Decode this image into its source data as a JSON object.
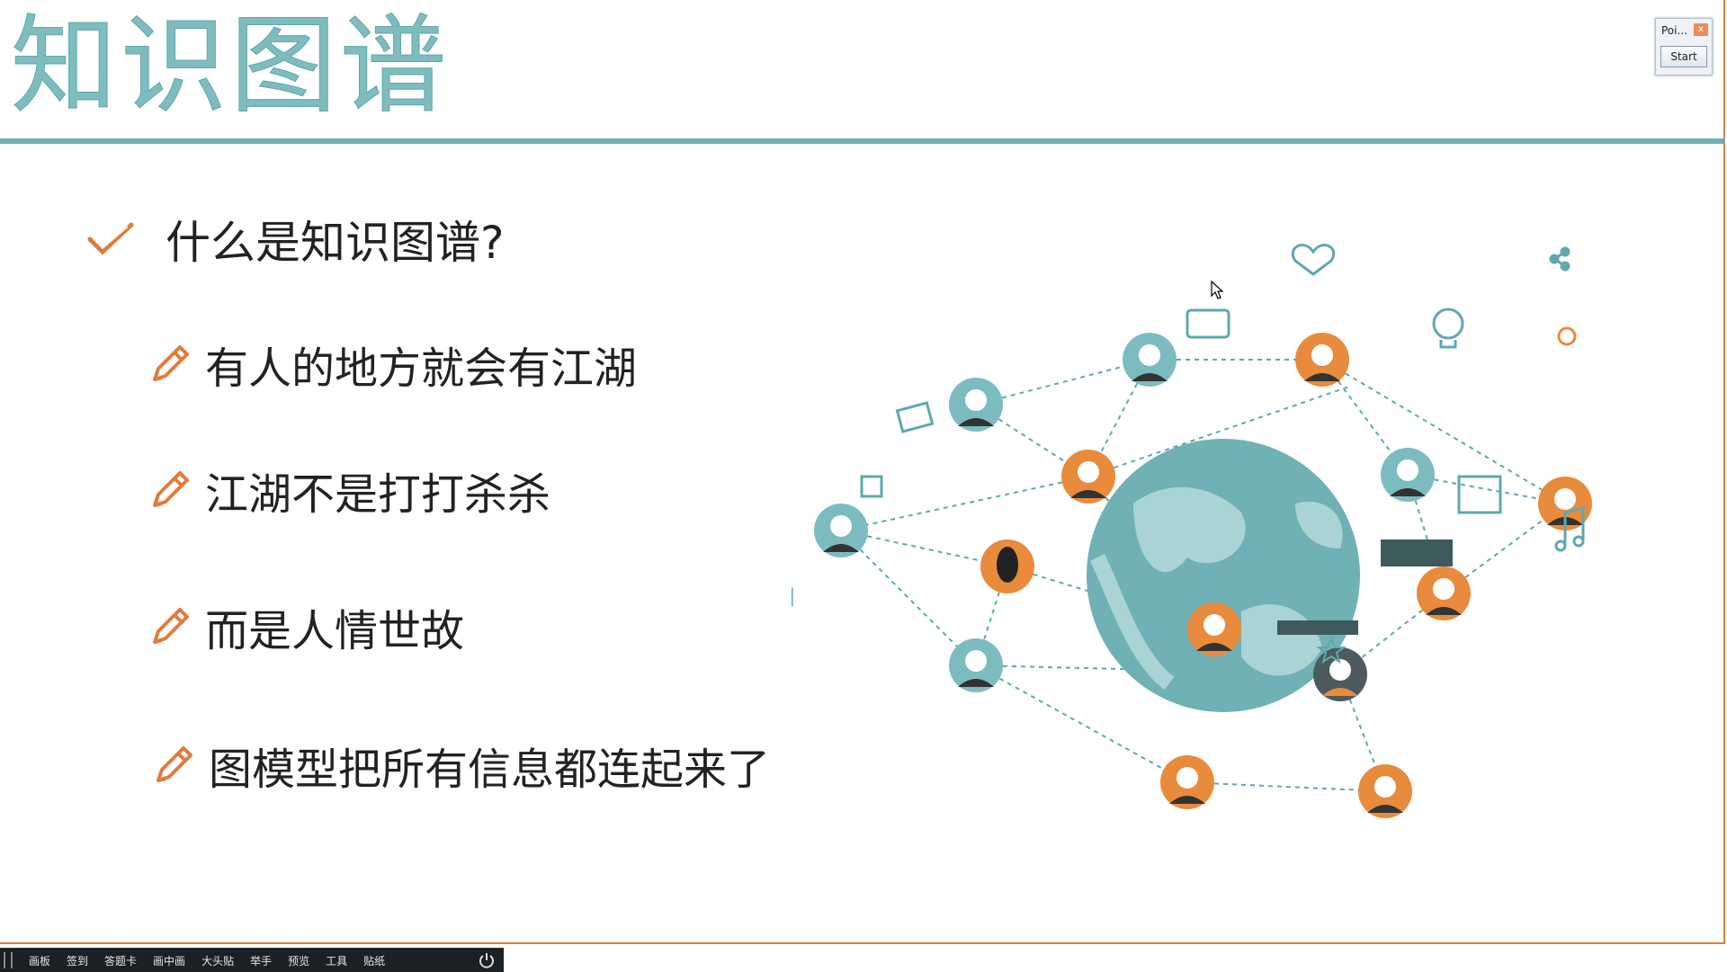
{
  "slide": {
    "title": "知识图谱",
    "bullets": [
      {
        "type": "check",
        "text": "什么是知识图谱?"
      },
      {
        "type": "pen",
        "text": "有人的地方就会有江湖"
      },
      {
        "type": "pen",
        "text": "江湖不是打打杀杀"
      },
      {
        "type": "pen",
        "text": "而是人情世故"
      },
      {
        "type": "pen",
        "text": "图模型把所有信息都连起来了"
      }
    ]
  },
  "widget": {
    "title": "Poi...",
    "close": "x",
    "start_label": "Start"
  },
  "taskbar": {
    "items": [
      "画板",
      "签到",
      "答题卡",
      "画中画",
      "大头贴",
      "举手",
      "预览",
      "工具",
      "贴纸"
    ]
  },
  "colors": {
    "accent_teal": "#6fb1b5",
    "accent_orange": "#e07b3c",
    "avatar_teal": "#7cbcc0",
    "avatar_orange": "#e98b3c"
  }
}
